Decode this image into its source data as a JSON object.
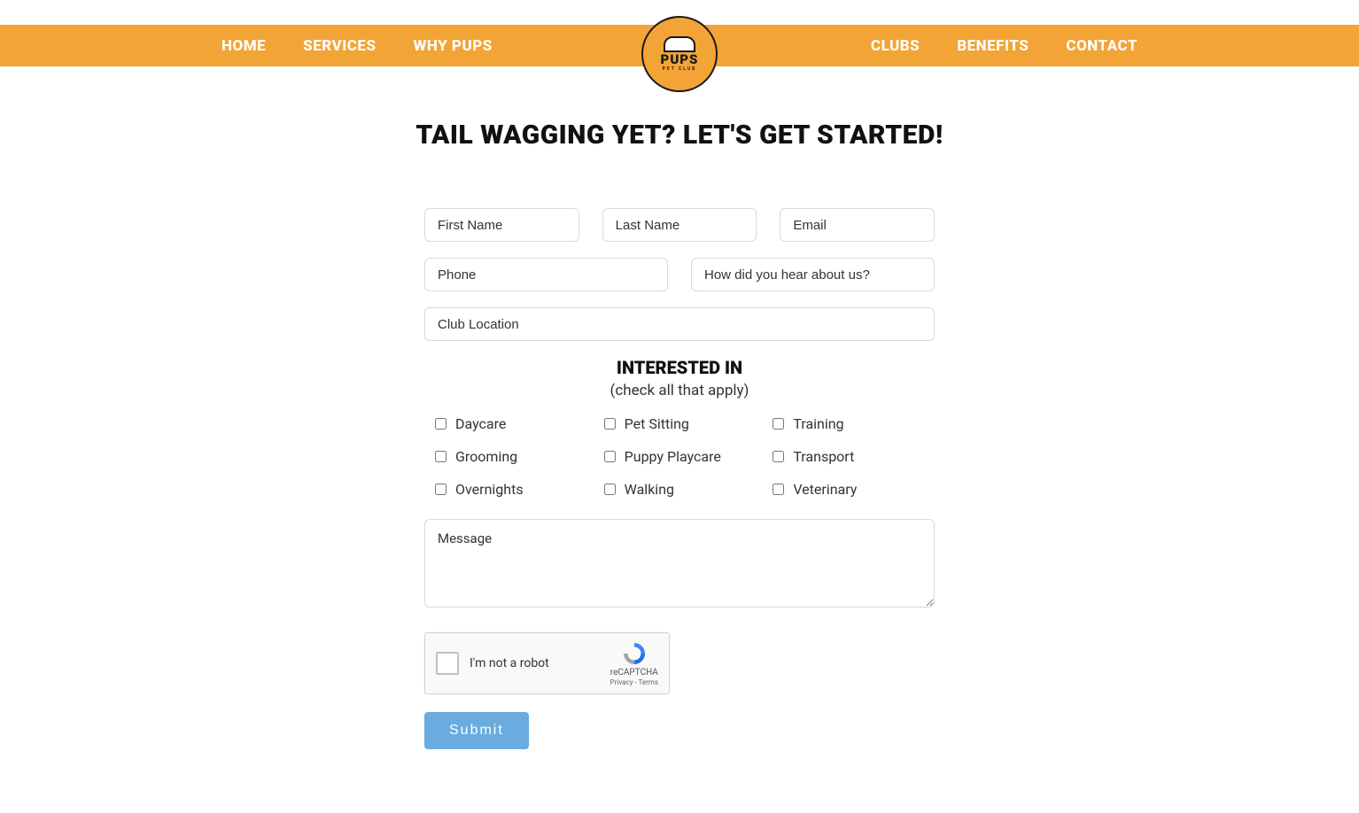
{
  "nav": {
    "left": [
      "HOME",
      "SERVICES",
      "WHY PUPS"
    ],
    "right": [
      "CLUBS",
      "BENEFITS",
      "CONTACT"
    ]
  },
  "logo": {
    "main": "PUPS",
    "sub": "PET CLUB"
  },
  "page_title": "TAIL WAGGING YET? LET'S GET STARTED!",
  "form": {
    "first_name_placeholder": "First Name",
    "last_name_placeholder": "Last Name",
    "email_placeholder": "Email",
    "phone_placeholder": "Phone",
    "hear_placeholder": "How did you hear about us?",
    "location_placeholder": "Club Location",
    "message_placeholder": "Message"
  },
  "interested": {
    "title": "INTERESTED IN",
    "subtitle": "(check all that apply)",
    "options": [
      "Daycare",
      "Grooming",
      "Overnights",
      "Pet Sitting",
      "Puppy Playcare",
      "Walking",
      "Training",
      "Transport",
      "Veterinary"
    ]
  },
  "captcha": {
    "label": "I'm not a robot",
    "brand": "reCAPTCHA",
    "links": "Privacy - Terms"
  },
  "submit_label": "Submit"
}
